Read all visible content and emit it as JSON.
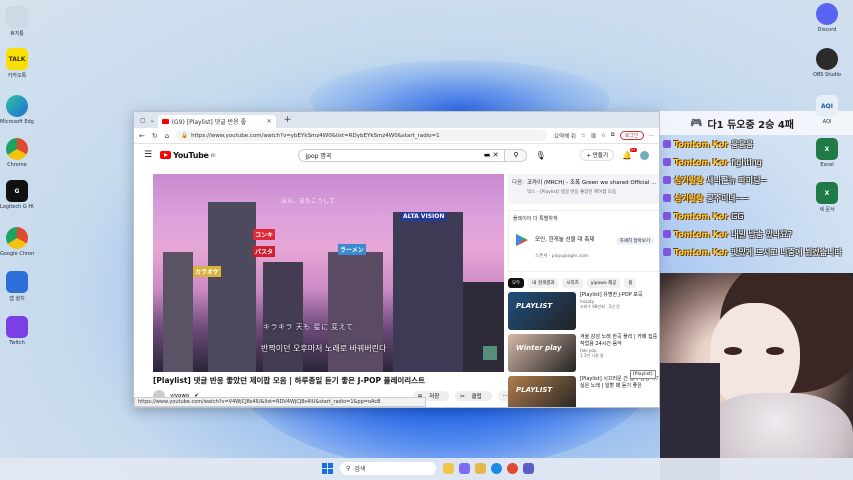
{
  "desktop": {
    "left_icons": [
      {
        "label": "휴지통",
        "icon": "recycle-bin-icon",
        "color": "#cfd8e6"
      },
      {
        "label": "카카오톡",
        "icon": "kakaotalk-icon",
        "color": "#f9e000",
        "glyph": "TALK"
      },
      {
        "label": "Microsoft Edge",
        "icon": "edge-icon",
        "color": "#1a8be0"
      },
      {
        "label": "Chrome",
        "icon": "chrome-icon",
        "color": "#e04a2f"
      },
      {
        "label": "Logitech G HUB",
        "icon": "ghub-icon",
        "color": "#111111",
        "glyph": "G"
      },
      {
        "label": "Google Chrome",
        "icon": "chrome-icon",
        "color": "#e04a2f"
      },
      {
        "label": "앱 설치",
        "icon": "installer-icon",
        "color": "#2c6fd6"
      },
      {
        "label": "Twitch",
        "icon": "twitch-icon",
        "color": "#7b3fe4"
      }
    ],
    "right_icons": [
      {
        "label": "Discord",
        "icon": "discord-icon",
        "color": "#5865f2"
      },
      {
        "label": "OBS Studio",
        "icon": "obs-icon",
        "color": "#2b2b2b"
      },
      {
        "label": "AQI",
        "icon": "app-icon",
        "color": "#e6eef8",
        "glyph": "AQI"
      },
      {
        "label": "Excel",
        "icon": "excel-icon",
        "color": "#1f7a45",
        "glyph": "X"
      },
      {
        "label": "새 문서",
        "icon": "excel-icon",
        "color": "#1f7a45",
        "glyph": "X"
      }
    ]
  },
  "browser": {
    "tab_title": "(G9) [Playlist] 댓글 반응 좋",
    "url": "https://www.youtube.com/watch?v=ybEYkSmz4W0&list=RDybEYkSmz4W0&start_radio=1",
    "summary_label": "요약해 줘",
    "profile_label": "로그인",
    "status_url": "https://www.youtube.com/watch?v=V4WjCJ8s4IU&list=RDV4WjCJ8s4IU&start_radio=1&pp=oAcB"
  },
  "youtube": {
    "logo_text": "YouTube",
    "logo_region": "KR",
    "search_value": "jpop 명곡",
    "create_label": "만들기",
    "notification_count": "9+",
    "video_title": "[Playlist] 댓글 반응 좋았던 제이팝 모음 | 하루종일 듣기 좋은 J-POP 플레이리스트",
    "video_overlay_jp": "キラキラ 天も 星に 変えて",
    "video_overlay_kr": "반짝이던 오후마저 노래로 바꿔버린다",
    "video_top_jp": "ほら、またこうして",
    "channel": "yiyowo",
    "actions": [
      "저장",
      "클립",
      "..."
    ],
    "related_top": {
      "label": "다음:",
      "text": "코카이 (MRCH) - 조폭 Green we shared Official ...",
      "sub": "믹스 - [Playlist] 댓글 반응 좋았던 제이팝 모음"
    },
    "ad": {
      "header": "플레이어 더 특별하게",
      "text": "모인, 한게놀 선물 대 축제",
      "sub": "스폰서 · play.google.com",
      "button": "자세히 알아보기"
    },
    "chips": [
      "모두",
      "내 검색결과",
      "시리즈",
      "yiyowo 제공",
      "플"
    ],
    "related": [
      {
        "thumb": "PLAYLIST",
        "title": "[Playlist] 유명한 J-POP 모곡",
        "channel": "miozky",
        "meta": "조회수 98만회 · 2년 전",
        "color": "#1f4f7e"
      },
      {
        "thumb": "Winter play",
        "title": "겨울 감성 노래 한곡 플리 | 카페 집중 작업용 24시간 음악",
        "channel": "tide pop",
        "meta": "1.3만 시청 중",
        "color": "#d6b9a6"
      },
      {
        "thumb": "PLAYLIST",
        "title": "[Playlist] 시끄러운 건 싫지 동정 하기 싫은 노래 | 일할 때 듣기 좋은",
        "channel": "",
        "meta": "",
        "color": "#b07e4c"
      }
    ],
    "tooltip": "[Playlist]"
  },
  "stream_chat": {
    "title": "다1 듀오중 2승 4패",
    "messages": [
      {
        "nick": "Tomtom Kor",
        "text": "응응응"
      },
      {
        "nick": "Tomtom Kor",
        "text": "fighting"
      },
      {
        "nick": "심기일탕",
        "text": "세나근뉴 파이팅~"
      },
      {
        "nick": "심기일탕",
        "text": "공주이네~~"
      },
      {
        "nick": "Tomtom Kor",
        "text": "GG"
      },
      {
        "nick": "Tomtom Kor",
        "text": "내일 방송 있나요?"
      },
      {
        "nick": "Tomtom Kor",
        "text": "맛있게 드시고 나중에 뵙겠습니다"
      }
    ]
  },
  "taskbar": {
    "search_placeholder": "검색",
    "apps": [
      {
        "icon": "file-explorer-icon",
        "color": "#f0c54a"
      },
      {
        "icon": "copilot-icon",
        "color": "#7b6cf0"
      },
      {
        "icon": "folder-icon",
        "color": "#e6b84a"
      },
      {
        "icon": "edge-icon",
        "color": "#1a8be0"
      },
      {
        "icon": "chrome-icon",
        "color": "#e04a2f"
      },
      {
        "icon": "teams-icon",
        "color": "#5b5fc7"
      }
    ]
  }
}
